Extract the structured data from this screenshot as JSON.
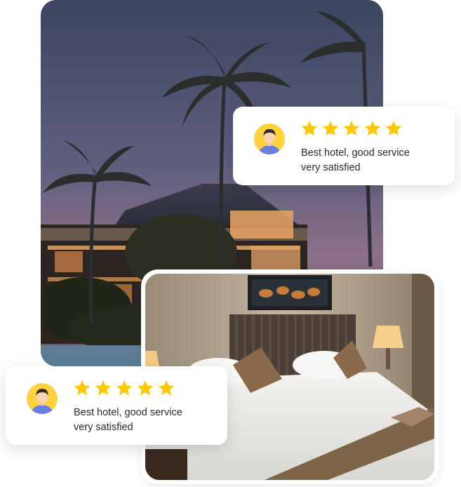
{
  "reviews": [
    {
      "avatar_icon": "user-avatar-icon",
      "rating": 5,
      "star_icon": "star-icon",
      "text_line1": "Best hotel, good service",
      "text_line2": "very satisfied"
    },
    {
      "avatar_icon": "user-avatar-icon",
      "rating": 5,
      "star_icon": "star-icon",
      "text_line1": "Best hotel, good service",
      "text_line2": "very satisfied"
    }
  ],
  "colors": {
    "star": "#FFC700",
    "avatar_bg": "#FFD23F",
    "text": "#2B2B2B",
    "card_bg": "#FFFFFF"
  }
}
